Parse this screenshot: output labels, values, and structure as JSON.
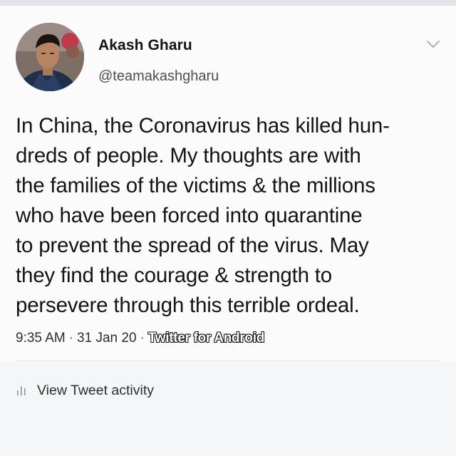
{
  "author": {
    "name": "Akash Gharu",
    "handle": "@teamakashgharu"
  },
  "tweet": {
    "lines": [
      "In China, the Coronavirus has killed hun-",
      "dreds of people. My thoughts are with",
      "the families of the victims & the millions",
      "who have been forced into quarantine",
      "to prevent the spread of the virus. May",
      "they find the courage & strength to",
      "persevere through this terrible ordeal."
    ]
  },
  "meta": {
    "time": "9:35 AM",
    "separator": "·",
    "date": "31 Jan 20",
    "client": "Twitter for Android"
  },
  "activity": {
    "label": "View Tweet activity"
  },
  "icons": {
    "menu": "chevron-down-icon",
    "activity": "bar-chart-icon"
  },
  "colors": {
    "background": "#fbfbfb",
    "text": "#141414",
    "secondary_text": "#4a4f54",
    "chevron": "#aab8c2"
  }
}
